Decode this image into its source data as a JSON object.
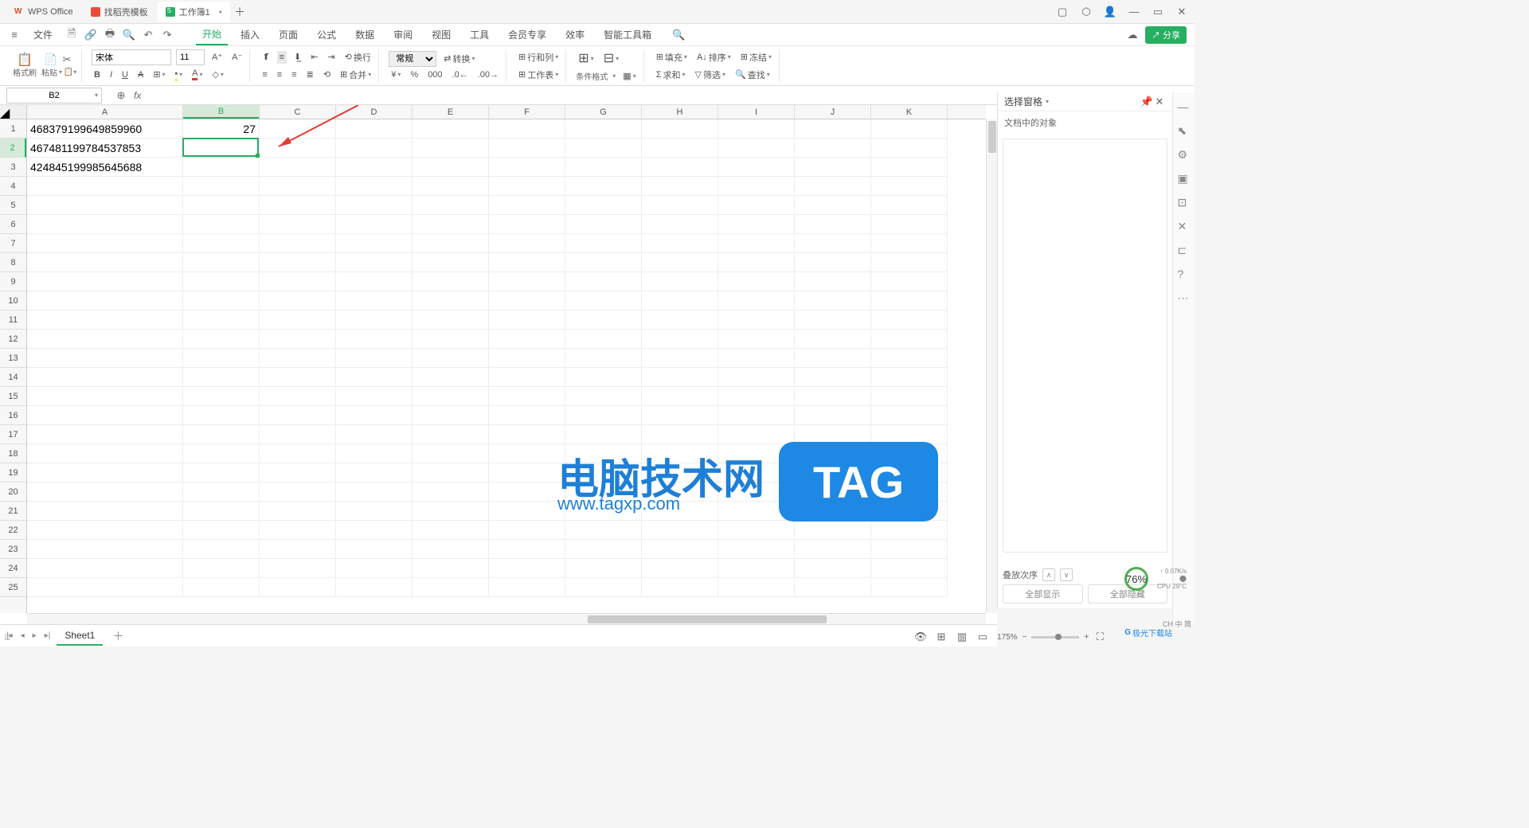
{
  "titlebar": {
    "tabs": [
      {
        "label": "WPS Office",
        "icon": "wps"
      },
      {
        "label": "找稻壳模板",
        "icon": "docer"
      },
      {
        "label": "工作簿1",
        "icon": "sheet",
        "active": true
      }
    ]
  },
  "menubar": {
    "file": "文件",
    "items": [
      "开始",
      "插入",
      "页面",
      "公式",
      "数据",
      "审阅",
      "视图",
      "工具",
      "会员专享",
      "效率",
      "智能工具箱"
    ],
    "active": "开始",
    "share": "分享"
  },
  "ribbon": {
    "format_painter": "格式刷",
    "paste": "粘贴",
    "font_name": "宋体",
    "font_size": "11",
    "wrap": "换行",
    "merge": "合并",
    "number_format": "常规",
    "convert": "转换",
    "cond_format": "条件格式",
    "rowcol": "行和列",
    "worksheet": "工作表",
    "fill": "填充",
    "sort": "排序",
    "freeze": "冻结",
    "sum": "求和",
    "filter": "筛选",
    "find": "查找"
  },
  "namebox": "B2",
  "grid": {
    "col_widths": {
      "A": 196,
      "other": 96
    },
    "columns": [
      "A",
      "B",
      "C",
      "D",
      "E",
      "F",
      "G",
      "H",
      "I",
      "J",
      "K"
    ],
    "selected_col": "B",
    "selected_row": 2,
    "rows": 25,
    "data": {
      "A1": "468379199649859960",
      "A2": "467481199784537853",
      "A3": "424845199985645688",
      "B1": "27"
    },
    "active_cell": "B2"
  },
  "sidepanel": {
    "title": "选择窗格",
    "objects_label": "文档中的对象",
    "stack_order": "叠放次序",
    "show_all": "全部显示",
    "hide_all": "全部隐藏"
  },
  "sheets": {
    "active": "Sheet1"
  },
  "statusbar": {
    "zoom": "175%"
  },
  "watermark": {
    "text_cn": "电脑技术网",
    "url": "www.tagxp.com",
    "tag": "TAG",
    "cpu_pct": "76%",
    "net": "0.07K/s",
    "cpu_temp": "CPU 29°C",
    "site2": "极光下载站",
    "ime": "CH 中 简"
  }
}
